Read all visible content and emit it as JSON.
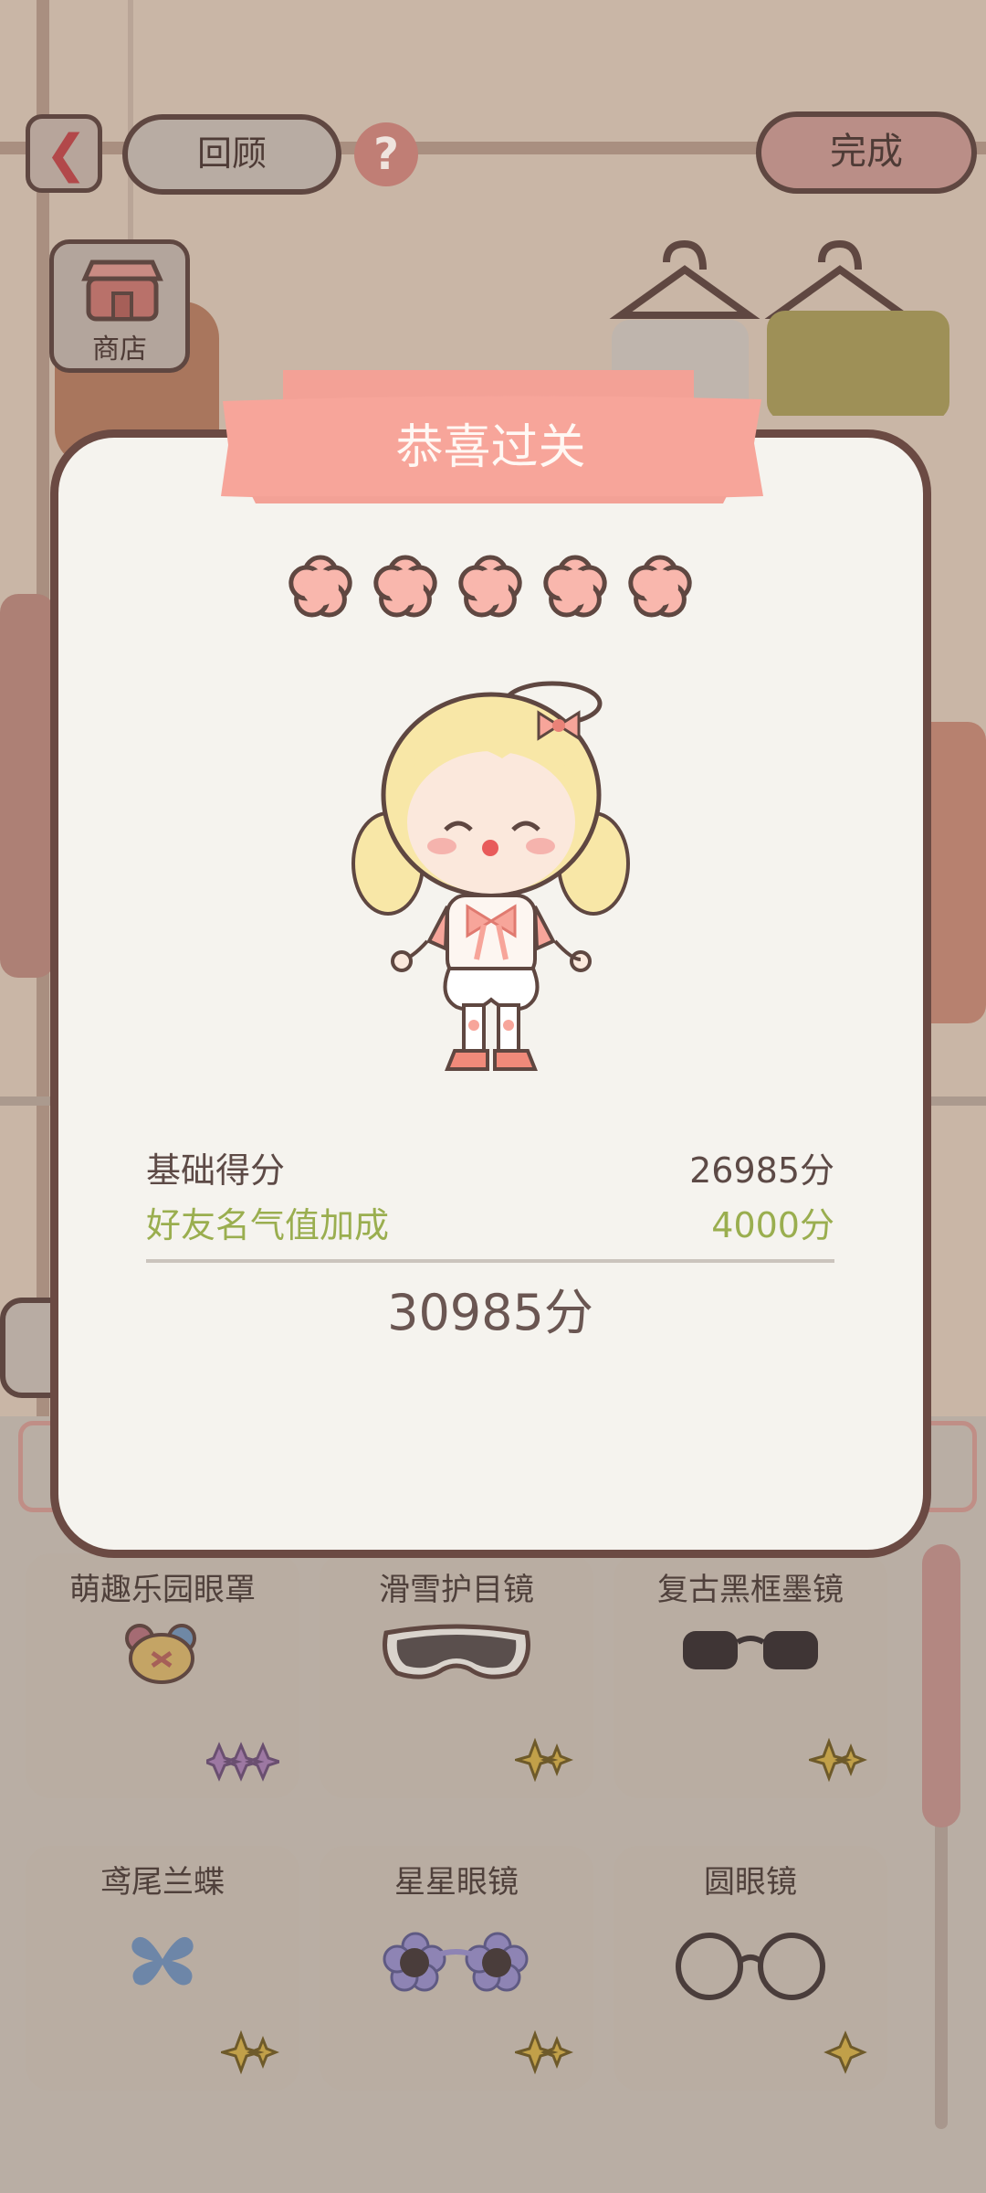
{
  "topbar": {
    "review_label": "回顾",
    "help_symbol": "?",
    "done_label": "完成",
    "shop_label": "商店"
  },
  "dialog": {
    "title": "恭喜过关",
    "stars_filled": 5,
    "stars_total": 5,
    "base_label": "基础得分",
    "base_value": "26985分",
    "bonus_label": "好友名气值加成",
    "bonus_value": "4000分",
    "total_value": "30985分"
  },
  "items": [
    {
      "name": "萌趣乐园眼罩",
      "icon": "bear-mask-icon",
      "rarity": "purple"
    },
    {
      "name": "滑雪护目镜",
      "icon": "ski-goggles-icon",
      "rarity": "gold"
    },
    {
      "name": "复古黑框墨镜",
      "icon": "sunglasses-icon",
      "rarity": "gold"
    },
    {
      "name": "鸢尾兰蝶",
      "icon": "butterfly-icon",
      "rarity": "gold"
    },
    {
      "name": "星星眼镜",
      "icon": "flower-glasses-icon",
      "rarity": "gold"
    },
    {
      "name": "圆眼镜",
      "icon": "round-glasses-icon",
      "rarity": "gold"
    }
  ],
  "colors": {
    "accent": "#f7a59a",
    "outline": "#6b4a43",
    "bonus_green": "#9aae4f",
    "dialog_bg": "#f5f3ee"
  }
}
